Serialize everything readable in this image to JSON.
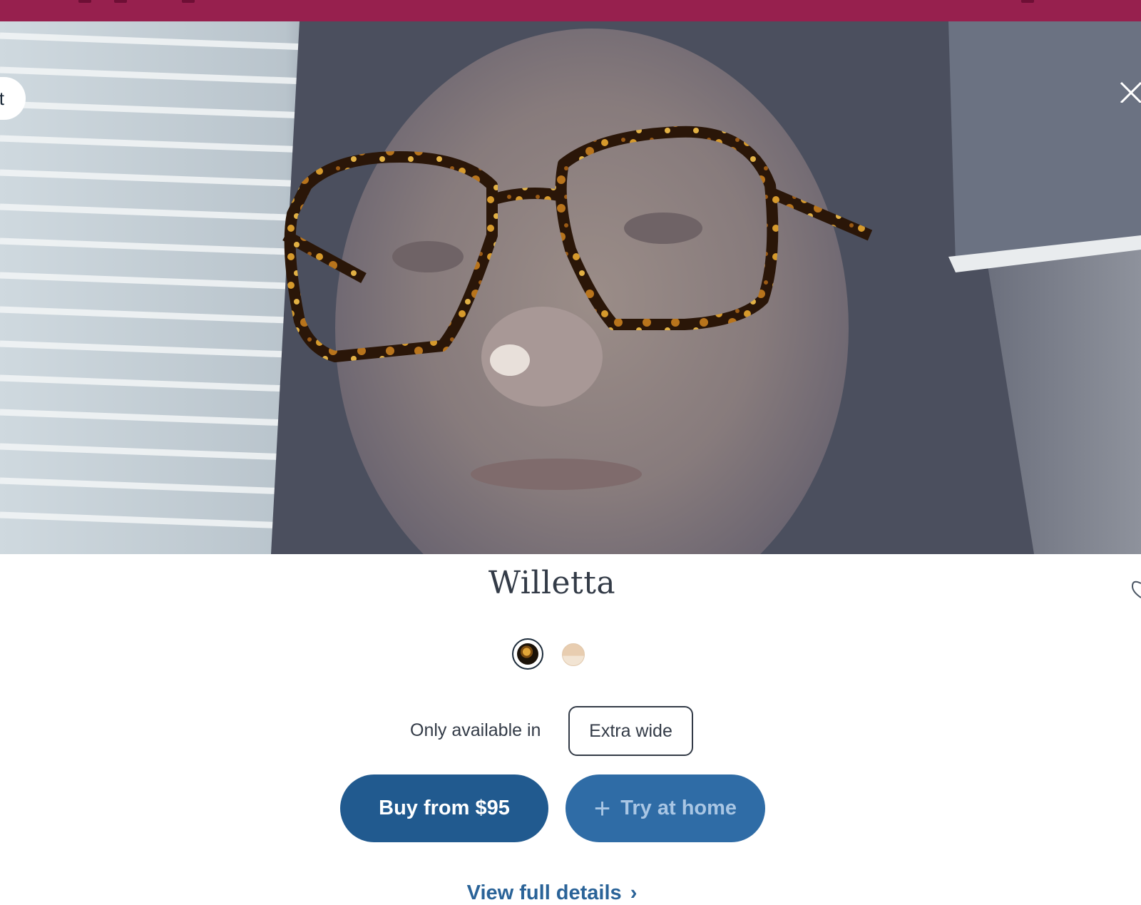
{
  "colors": {
    "topbar": "#97204e",
    "primary_button": "#215a8f",
    "secondary_button": "#2f6ca6",
    "text": "#333b47",
    "link": "#2a6398"
  },
  "camera": {
    "back_label": "t",
    "close_icon": "close-icon"
  },
  "product": {
    "name": "Willetta",
    "swatches": [
      {
        "name": "tortoise",
        "selected": true
      },
      {
        "name": "crystal-peach",
        "selected": false
      }
    ],
    "availability_text": "Only available in",
    "width_option": "Extra wide"
  },
  "actions": {
    "buy_label": "Buy from $95",
    "try_icon": "+",
    "try_label": "Try at home",
    "details_label": "View full details",
    "details_chevron": "›"
  }
}
